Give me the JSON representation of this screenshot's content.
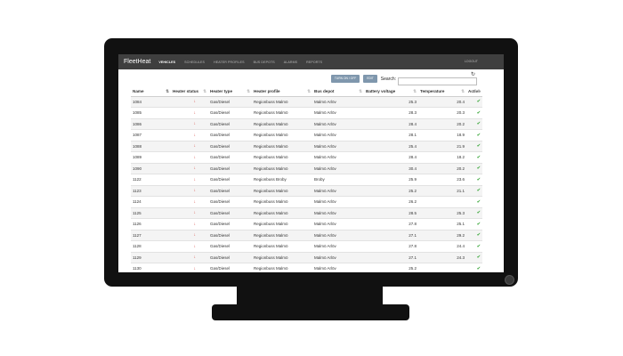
{
  "app": {
    "title": "FleetHeat",
    "logout": "LOGOUT"
  },
  "nav": [
    "VEHICLES",
    "SCHEDULES",
    "HEATER PROFILES",
    "BUS DEPOTS",
    "ALARMS",
    "REPORTS"
  ],
  "toolbar": {
    "turn_on_off": "TURN ON / OFF",
    "edit": "EDIT",
    "search_label": "Search:",
    "search_placeholder": ""
  },
  "icons": {
    "status": "arrow-down-icon",
    "active": "check-icon",
    "sort": "sort-icon",
    "refresh": "refresh-icon"
  },
  "colors": {
    "navbar": "#3f3f3f",
    "button": "#7f97ad",
    "status_down": "#d9534f",
    "active_check": "#4cae4c"
  },
  "table": {
    "columns": [
      "Name",
      "Heater status",
      "Heater type",
      "Heater profile",
      "Bus depot",
      "Battery voltage",
      "Temperature",
      "Active"
    ],
    "rows": [
      {
        "name": "1084",
        "type": "Gas/Diesel",
        "profile": "Regionbuss Malmö",
        "depot": "Malmö Arlöv",
        "voltage": "25.3",
        "temp": "20.4"
      },
      {
        "name": "1085",
        "type": "Gas/Diesel",
        "profile": "Regionbuss Malmö",
        "depot": "Malmö Arlöv",
        "voltage": "28.3",
        "temp": "20.3"
      },
      {
        "name": "1086",
        "type": "Gas/Diesel",
        "profile": "Regionbuss Malmö",
        "depot": "Malmö Arlöv",
        "voltage": "28.4",
        "temp": "20.2"
      },
      {
        "name": "1087",
        "type": "Gas/Diesel",
        "profile": "Regionbuss Malmö",
        "depot": "Malmö Arlöv",
        "voltage": "28.1",
        "temp": "18.9"
      },
      {
        "name": "1088",
        "type": "Gas/Diesel",
        "profile": "Regionbuss Malmö",
        "depot": "Malmö Arlöv",
        "voltage": "25.4",
        "temp": "21.9"
      },
      {
        "name": "1089",
        "type": "Gas/Diesel",
        "profile": "Regionbuss Malmö",
        "depot": "Malmö Arlöv",
        "voltage": "28.4",
        "temp": "18.2"
      },
      {
        "name": "1090",
        "type": "Gas/Diesel",
        "profile": "Regionbuss Malmö",
        "depot": "Malmö Arlöv",
        "voltage": "30.4",
        "temp": "20.2"
      },
      {
        "name": "1122",
        "type": "Gas/Diesel",
        "profile": "Regionbuss Broby",
        "depot": "Broby",
        "voltage": "25.9",
        "temp": "23.6"
      },
      {
        "name": "1123",
        "type": "Gas/Diesel",
        "profile": "Regionbuss Malmö",
        "depot": "Malmö Arlöv",
        "voltage": "25.2",
        "temp": "21.1"
      },
      {
        "name": "1124",
        "type": "Gas/Diesel",
        "profile": "Regionbuss Malmö",
        "depot": "Malmö Arlöv",
        "voltage": "26.2",
        "temp": ""
      },
      {
        "name": "1125",
        "type": "Gas/Diesel",
        "profile": "Regionbuss Malmö",
        "depot": "Malmö Arlöv",
        "voltage": "28.5",
        "temp": "25.3"
      },
      {
        "name": "1126",
        "type": "Gas/Diesel",
        "profile": "Regionbuss Malmö",
        "depot": "Malmö Arlöv",
        "voltage": "27.8",
        "temp": "25.1"
      },
      {
        "name": "1127",
        "type": "Gas/Diesel",
        "profile": "Regionbuss Malmö",
        "depot": "Malmö Arlöv",
        "voltage": "27.1",
        "temp": "29.2"
      },
      {
        "name": "1128",
        "type": "Gas/Diesel",
        "profile": "Regionbuss Malmö",
        "depot": "Malmö Arlöv",
        "voltage": "27.8",
        "temp": "24.4"
      },
      {
        "name": "1129",
        "type": "Gas/Diesel",
        "profile": "Regionbuss Malmö",
        "depot": "Malmö Arlöv",
        "voltage": "27.1",
        "temp": "24.3"
      },
      {
        "name": "1130",
        "type": "Gas/Diesel",
        "profile": "Regionbuss Malmö",
        "depot": "Malmö Arlöv",
        "voltage": "25.2",
        "temp": ""
      }
    ]
  }
}
